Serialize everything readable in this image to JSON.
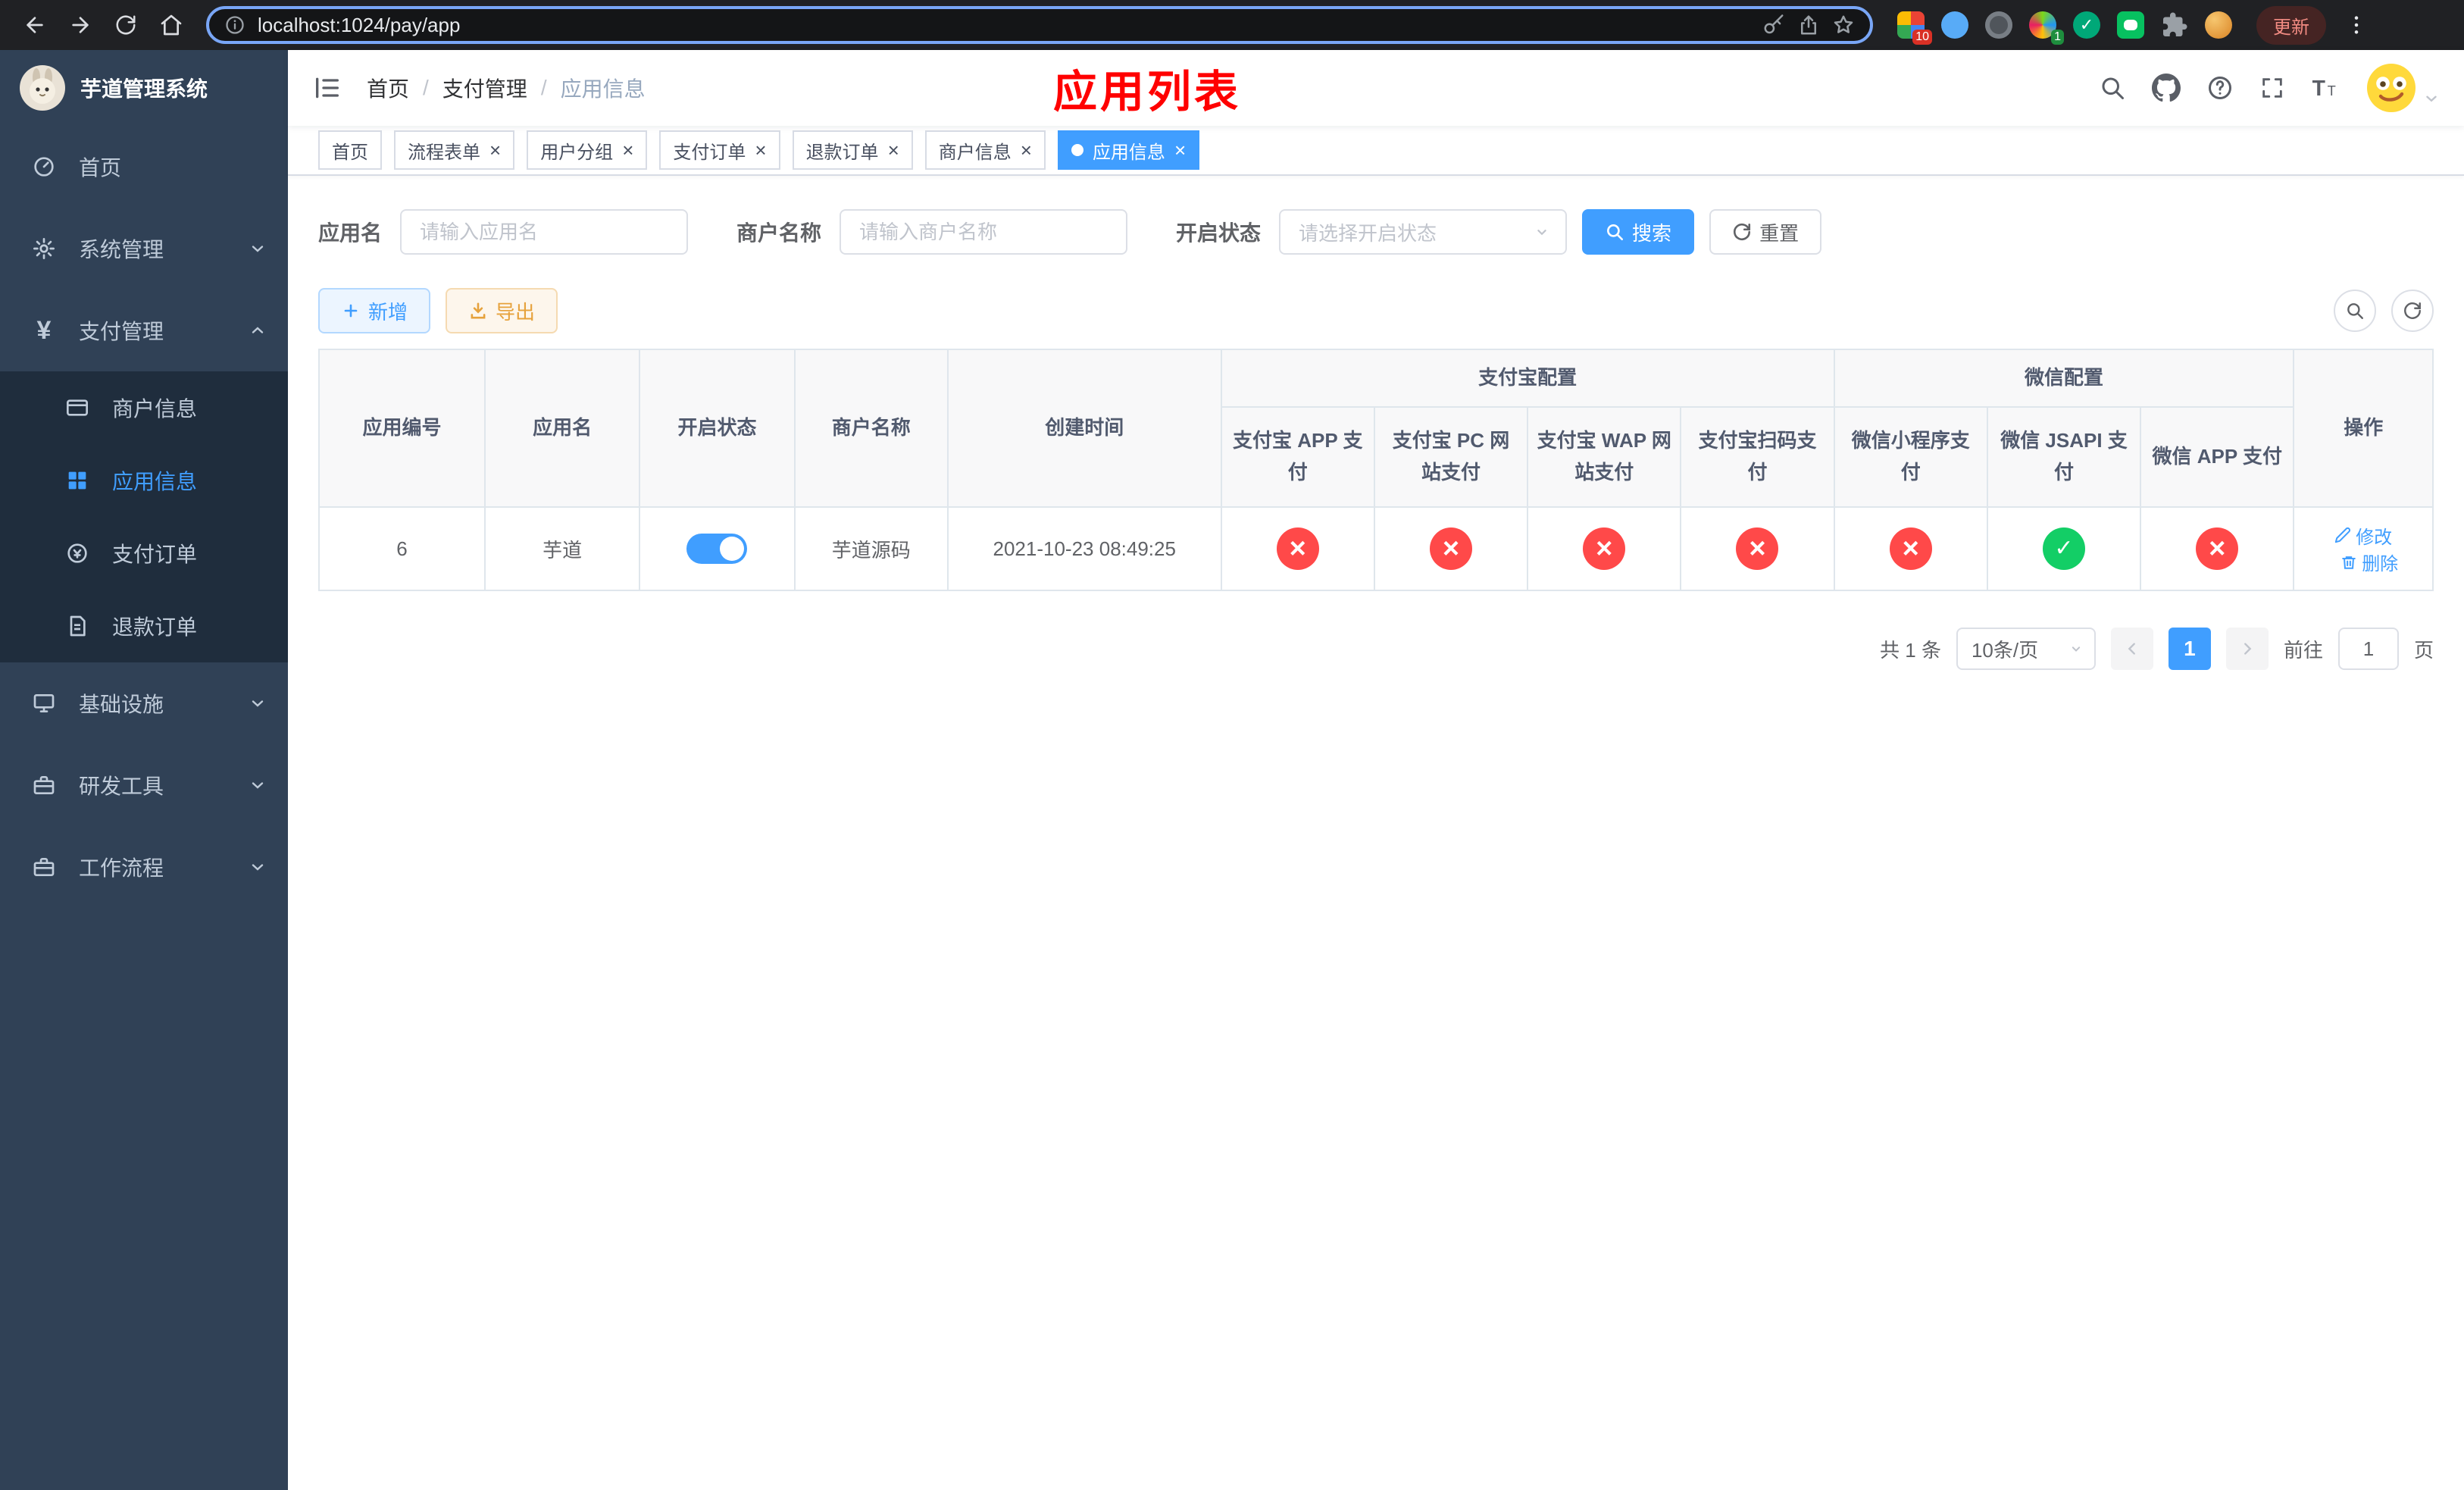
{
  "browser": {
    "url": "localhost:1024/pay/app",
    "update_label": "更新",
    "ext_badge_grid": "10",
    "ext_badge_avatar": "1"
  },
  "sidebar": {
    "title": "芋道管理系统",
    "home": "首页",
    "system": "系统管理",
    "payment": "支付管理",
    "merchant_info": "商户信息",
    "app_info": "应用信息",
    "pay_order": "支付订单",
    "refund_order": "退款订单",
    "infra": "基础设施",
    "dev_tools": "研发工具",
    "workflow": "工作流程"
  },
  "header": {
    "breadcrumb_home": "首页",
    "breadcrumb_payment": "支付管理",
    "breadcrumb_current": "应用信息",
    "overlay_title": "应用列表"
  },
  "tabs": [
    {
      "label": "首页",
      "closable": false,
      "active": false
    },
    {
      "label": "流程表单",
      "closable": true,
      "active": false
    },
    {
      "label": "用户分组",
      "closable": true,
      "active": false
    },
    {
      "label": "支付订单",
      "closable": true,
      "active": false
    },
    {
      "label": "退款订单",
      "closable": true,
      "active": false
    },
    {
      "label": "商户信息",
      "closable": true,
      "active": false
    },
    {
      "label": "应用信息",
      "closable": true,
      "active": true
    }
  ],
  "filters": {
    "app_name_label": "应用名",
    "app_name_placeholder": "请输入应用名",
    "merchant_label": "商户名称",
    "merchant_placeholder": "请输入商户名称",
    "status_label": "开启状态",
    "status_placeholder": "请选择开启状态",
    "search_button": "搜索",
    "reset_button": "重置"
  },
  "toolbar": {
    "add_button": "新增",
    "export_button": "导出"
  },
  "table": {
    "group_alipay": "支付宝配置",
    "group_wechat": "微信配置",
    "col_id": "应用编号",
    "col_name": "应用名",
    "col_status": "开启状态",
    "col_merchant": "商户名称",
    "col_created": "创建时间",
    "col_ops": "操作",
    "alipay_cols": [
      "支付宝 APP 支付",
      "支付宝 PC 网站支付",
      "支付宝 WAP 网站支付",
      "支付宝扫码支付"
    ],
    "wechat_cols": [
      "微信小程序支付",
      "微信 JSAPI 支付",
      "微信 APP 支付"
    ],
    "rows": [
      {
        "id": "6",
        "name": "芋道",
        "enabled": true,
        "merchant": "芋道源码",
        "created": "2021-10-23 08:49:25",
        "statuses": [
          "no",
          "no",
          "no",
          "no",
          "no",
          "yes",
          "no"
        ],
        "edit": "修改",
        "delete": "删除"
      }
    ]
  },
  "pagination": {
    "total": "共 1 条",
    "page_size": "10条/页",
    "page": "1",
    "goto_label": "前往",
    "goto_value": "1",
    "page_unit": "页"
  },
  "colors": {
    "accent": "#409eff",
    "success": "#13ce66",
    "danger": "#ff4949",
    "warning": "#e6a23c",
    "overlay_title": "#ff0000",
    "sidebar_bg": "#304156",
    "submenu_bg": "#1f2d3d"
  }
}
